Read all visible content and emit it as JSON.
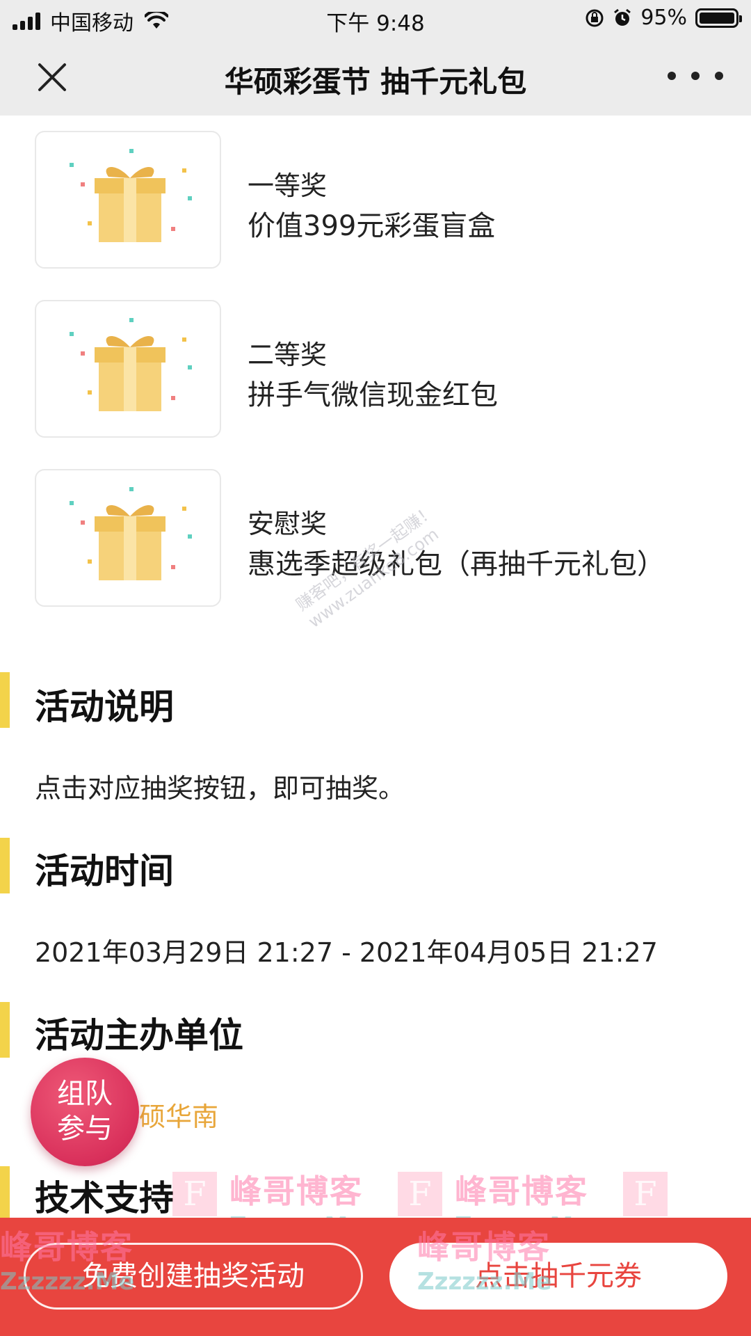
{
  "status_bar": {
    "carrier": "中国移动",
    "time": "下午 9:48",
    "battery": "95%"
  },
  "nav": {
    "title": "华硕彩蛋节 抽千元礼包"
  },
  "prizes": [
    {
      "level": "一等奖",
      "name": "价值399元彩蛋盲盒",
      "icon": "gift-box-icon"
    },
    {
      "level": "二等奖",
      "name": "拼手气微信现金红包",
      "icon": "gift-box-icon"
    },
    {
      "level": "安慰奖",
      "name": "惠选季超级礼包（再抽千元礼包）",
      "icon": "gift-box-icon"
    }
  ],
  "sections": {
    "description": {
      "title": "活动说明",
      "text": "点击对应抽奖按钮，即可抽奖。"
    },
    "time": {
      "title": "活动时间",
      "text": "2021年03月29日 21:27 - 2021年04月05日 21:27"
    },
    "organizer": {
      "title": "活动主办单位",
      "text": "硕华南"
    },
    "tech": {
      "title": "技术支持"
    }
  },
  "watermark": {
    "line1": "赚客吧，有奖一起赚！",
    "line2": "www.zuanke8.com"
  },
  "blog_watermark": {
    "name": "峰哥博客",
    "domain": "Zzzzzz.Me",
    "letter": "F"
  },
  "team_button": {
    "line1": "组队",
    "line2": "参与"
  },
  "bottom": {
    "free_create": "免费创建抽奖活动",
    "draw": "点击抽千元券"
  },
  "colors": {
    "accent_bar": "#f3d34a",
    "bottom_bar": "#e8453f",
    "team_button": "#d9305b",
    "organizer_text": "#e8a63a"
  }
}
